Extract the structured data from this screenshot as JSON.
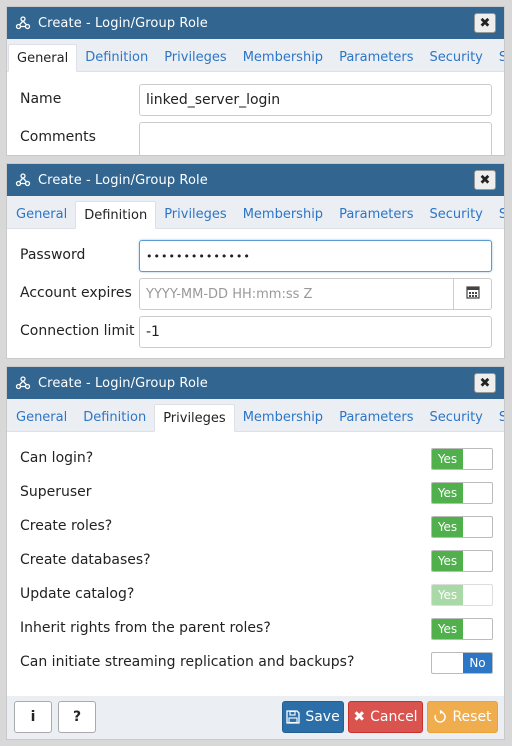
{
  "panels": [
    {
      "title": "Create - Login/Group Role",
      "tabs": [
        "General",
        "Definition",
        "Privileges",
        "Membership",
        "Parameters",
        "Security",
        "SQL"
      ],
      "active_tab": "General",
      "fields": {
        "name_label": "Name",
        "name_value": "linked_server_login",
        "comments_label": "Comments"
      }
    },
    {
      "title": "Create - Login/Group Role",
      "tabs": [
        "General",
        "Definition",
        "Privileges",
        "Membership",
        "Parameters",
        "Security",
        "SQL"
      ],
      "active_tab": "Definition",
      "fields": {
        "password_label": "Password",
        "password_value": "••••••••••••••",
        "expires_label": "Account expires",
        "expires_placeholder": "YYYY-MM-DD HH:mm:ss Z",
        "limit_label": "Connection limit",
        "limit_value": "-1"
      }
    },
    {
      "title": "Create - Login/Group Role",
      "tabs": [
        "General",
        "Definition",
        "Privileges",
        "Membership",
        "Parameters",
        "Security",
        "SQL"
      ],
      "active_tab": "Privileges",
      "privileges": [
        {
          "label": "Can login?",
          "value": "Yes",
          "on": true,
          "disabled": false
        },
        {
          "label": "Superuser",
          "value": "Yes",
          "on": true,
          "disabled": false
        },
        {
          "label": "Create roles?",
          "value": "Yes",
          "on": true,
          "disabled": false
        },
        {
          "label": "Create databases?",
          "value": "Yes",
          "on": true,
          "disabled": false
        },
        {
          "label": "Update catalog?",
          "value": "Yes",
          "on": true,
          "disabled": true
        },
        {
          "label": "Inherit rights from the parent roles?",
          "value": "Yes",
          "on": true,
          "disabled": false
        },
        {
          "label": "Can initiate streaming replication and backups?",
          "value": "No",
          "on": false,
          "disabled": false
        }
      ]
    }
  ],
  "footer": {
    "info_label": "i",
    "help_label": "?",
    "save_label": "Save",
    "cancel_label": "Cancel",
    "reset_label": "Reset"
  },
  "colors": {
    "titlebar": "#326690",
    "link": "#2c76c7",
    "toggle_on": "#4fb04c",
    "toggle_off": "#2c76c7",
    "save": "#2c6fa8",
    "cancel": "#d9534f",
    "reset": "#f0ad4e"
  }
}
